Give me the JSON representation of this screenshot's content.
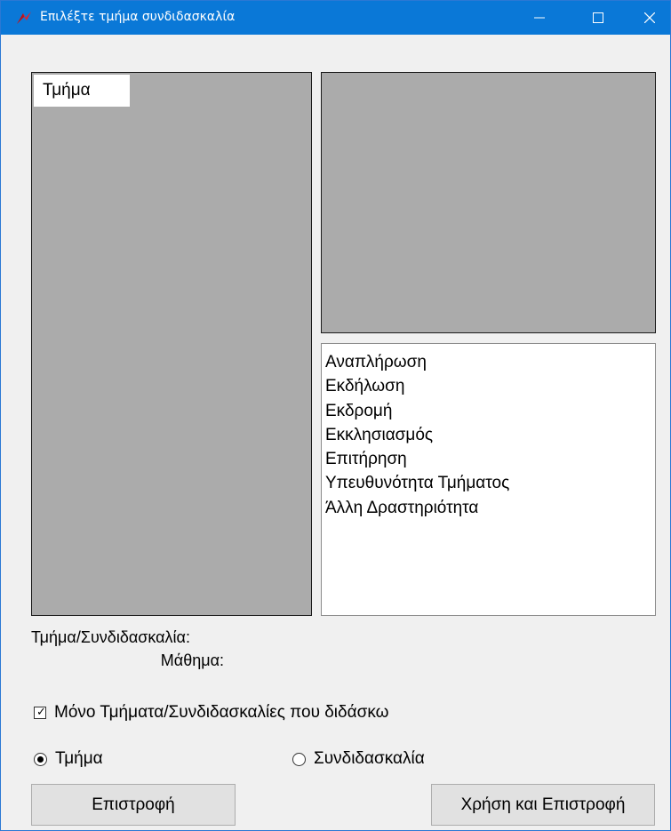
{
  "window": {
    "title": "Επιλέξτε τμήμα συνδιδασκαλία",
    "controls": {
      "minimize": "—",
      "maximize": "☐",
      "close": "✕"
    },
    "accent_color": "#0a78d7"
  },
  "left_panel": {
    "column_header": "Τμήμα"
  },
  "activity_list": {
    "items": [
      "Αναπλήρωση",
      "Εκδήλωση",
      "Εκδρομή",
      "Εκκλησιασμός",
      "Επιτήρηση",
      "Υπευθυνότητα Τμήματος",
      "Άλλη Δραστηριότητα"
    ]
  },
  "info": {
    "class_label": "Τμήμα/Συνδιδασκαλία:",
    "subject_label": "Μάθημα:"
  },
  "filter": {
    "label": "Μόνο Τμήματα/Συνδιδασκαλίες που διδάσκω",
    "checked": true
  },
  "mode": {
    "options": [
      {
        "label": "Τμήμα",
        "selected": true
      },
      {
        "label": "Συνδιδασκαλία",
        "selected": false
      }
    ]
  },
  "buttons": {
    "back": "Επιστροφή",
    "apply_back": "Χρήση και Επιστροφή"
  }
}
